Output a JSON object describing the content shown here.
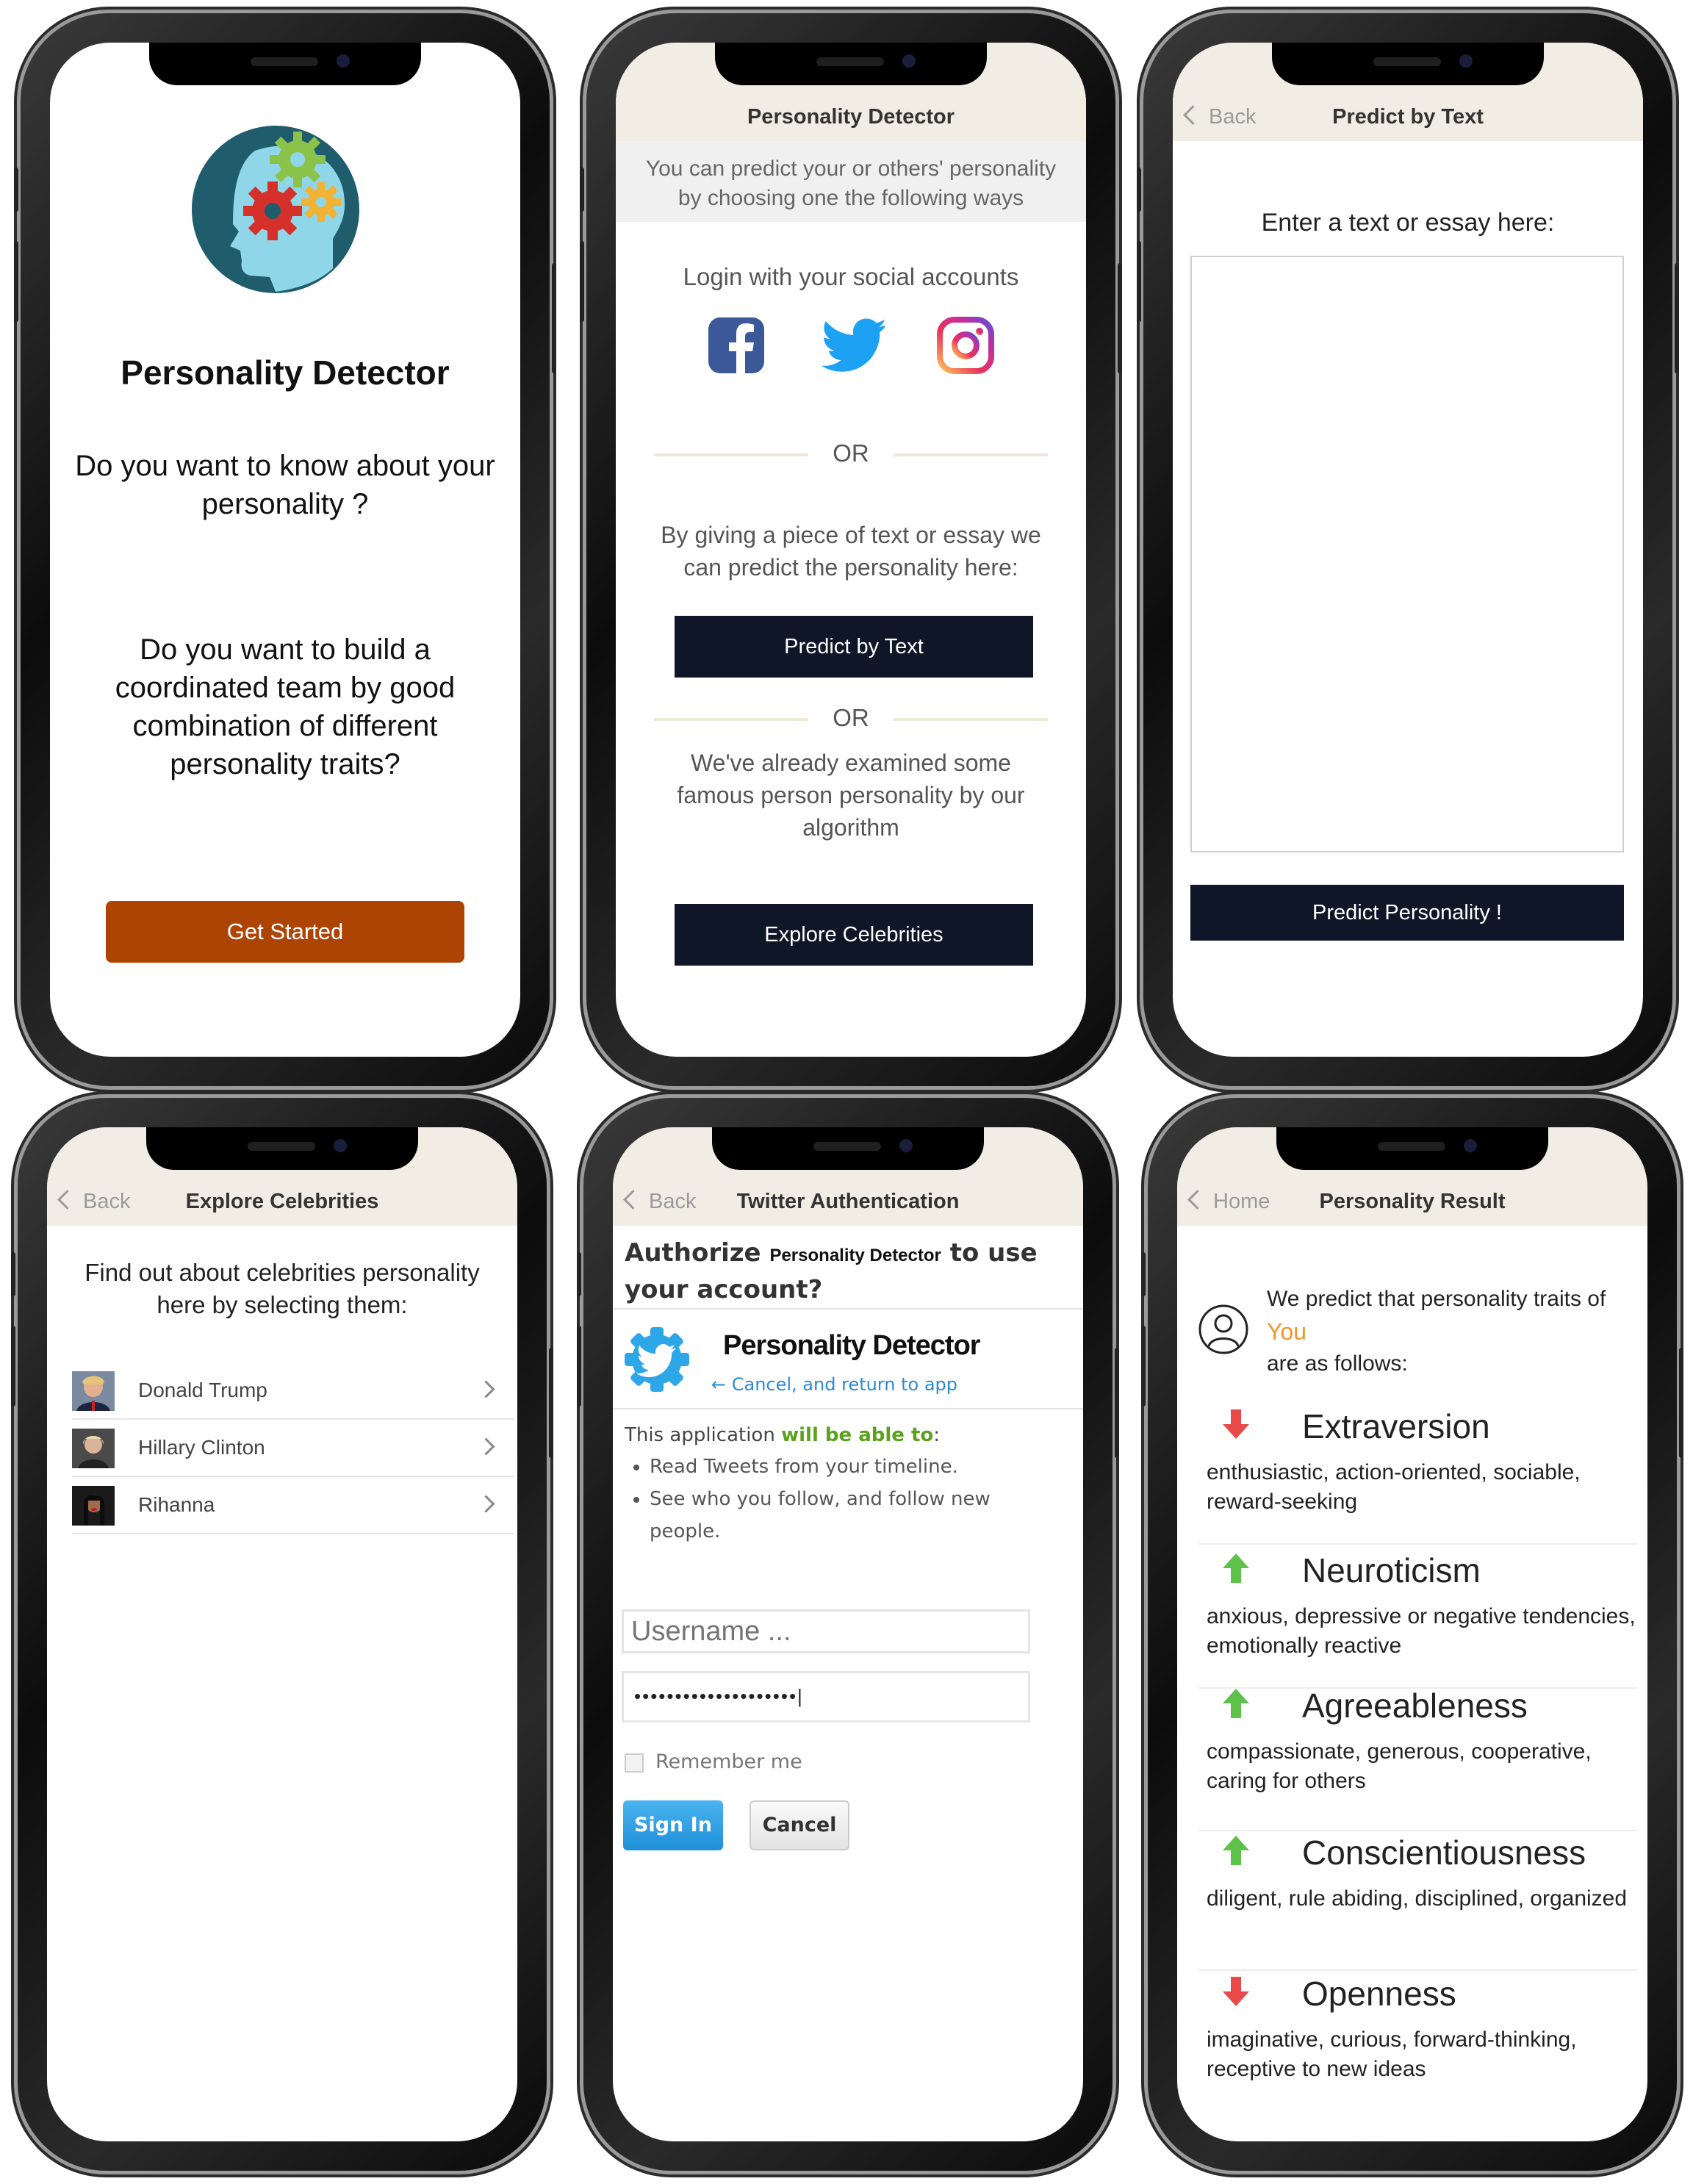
{
  "screen1": {
    "app_title": "Personality Detector",
    "question1": "Do you want to  know about your personality ?",
    "question2": "Do you want to build a coordinated team by good combination of different personality traits?",
    "get_started": "Get Started",
    "accent": "#ae4403"
  },
  "screen2": {
    "header_title": "Personality Detector",
    "intro": "You can predict your or others' personality by choosing one the following ways",
    "social_label": "Login with your social accounts",
    "social_icons": [
      "facebook-icon",
      "twitter-icon",
      "instagram-icon"
    ],
    "or1": "OR",
    "text_prompt": "By giving a piece of text or essay we can predict the personality here:",
    "predict_by_text": "Predict by Text",
    "or2": "OR",
    "celeb_prompt": "We've already examined some famous person personality by our algorithm",
    "explore_celebrities": "Explore Celebrities"
  },
  "screen3": {
    "back": "Back",
    "header_title": "Predict by Text",
    "prompt": "Enter a text or essay here:",
    "textarea_value": "",
    "predict_button": "Predict Personality !"
  },
  "screen4": {
    "back": "Back",
    "header_title": "Explore Celebrities",
    "intro": "Find out about celebrities personality here by selecting them:",
    "celebrities": [
      {
        "name": "Donald Trump"
      },
      {
        "name": "Hillary Clinton"
      },
      {
        "name": "Rihanna"
      }
    ]
  },
  "screen5": {
    "back": "Back",
    "header_title": "Twitter Authentication",
    "authorize_pre": "Authorize",
    "authorize_app": "Personality Detector",
    "authorize_post": "to use",
    "authorize_line2": "your account?",
    "app_name": "Personality Detector",
    "cancel_link": "← Cancel, and return to app",
    "perm_pre": "This application",
    "perm_strong": "will be able to",
    "perm_colon": ":",
    "permissions": [
      "Read Tweets from your timeline.",
      "See who you follow, and follow new people."
    ],
    "username_placeholder": "Username ...",
    "password_value": "••••••••••••••••••••|",
    "remember_me": "Remember me",
    "sign_in": "Sign In",
    "cancel": "Cancel"
  },
  "screen6": {
    "back": "Home",
    "header_title": "Personality Result",
    "predict_line1": "We predict that personality traits of",
    "subject": "You",
    "predict_line3": "are as follows:",
    "traits": [
      {
        "name": "Extraversion",
        "direction": "down",
        "desc": "enthusiastic, action-oriented, sociable, reward-seeking"
      },
      {
        "name": "Neuroticism",
        "direction": "up",
        "desc": "anxious, depressive or negative tendencies, emotionally reactive"
      },
      {
        "name": "Agreeableness",
        "direction": "up",
        "desc": "compassionate, generous, cooperative, caring for others"
      },
      {
        "name": "Conscientiousness",
        "direction": "up",
        "desc": "diligent, rule abiding, disciplined, organized"
      },
      {
        "name": "Openness",
        "direction": "down",
        "desc": "imaginative, curious, forward-thinking, receptive to new ideas"
      }
    ],
    "up_color": "#5ec24a",
    "down_color": "#e84a4a",
    "subject_color": "#f0962a"
  }
}
